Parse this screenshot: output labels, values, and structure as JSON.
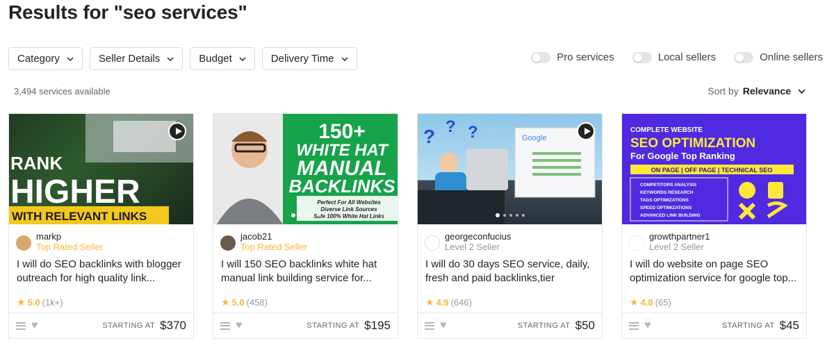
{
  "page_title": "Results for \"seo services\"",
  "filters": [
    "Category",
    "Seller Details",
    "Budget",
    "Delivery Time"
  ],
  "toggles": [
    "Pro services",
    "Local sellers",
    "Online sellers"
  ],
  "services_count": "3,494 services available",
  "sort": {
    "label": "Sort by",
    "value": "Relevance"
  },
  "footer": {
    "starting_at": "STARTING AT"
  },
  "gigs": [
    {
      "seller": "markp",
      "level": "Top Rated Seller",
      "title": "I will do SEO backlinks with blogger outreach for high quality link...",
      "rating": "5.0",
      "reviews": "(1k+)",
      "price": "$370",
      "thumb_text": [
        "RANK",
        "HIGHER",
        "WITH RELEVANT LINKS"
      ]
    },
    {
      "seller": "jacob21",
      "level": "Top Rated Seller",
      "title": "I will 150 SEO backlinks white hat manual link building service for...",
      "rating": "5.0",
      "reviews": "(458)",
      "price": "$195",
      "thumb_text": [
        "150+",
        "WHITE HAT",
        "MANUAL",
        "BACKLINKS",
        "Perfect For All Websites",
        "Diverse Link Sources",
        "Safe 100% White Hat Links"
      ]
    },
    {
      "seller": "georgeconfucius",
      "level": "Level 2 Seller",
      "title": "I will do 30 days SEO service, daily, fresh and paid backlinks,tier",
      "rating": "4.9",
      "reviews": "(646)",
      "price": "$50",
      "thumb_text": [
        "?",
        "?",
        "?",
        "Google"
      ]
    },
    {
      "seller": "growthpartner1",
      "level": "Level 2 Seller",
      "title": "I will do website on page SEO optimization service for google top...",
      "rating": "4.8",
      "reviews": "(65)",
      "price": "$45",
      "thumb_text": [
        "COMPLETE WEBSITE",
        "SEO OPTIMIZATION",
        "For Google Top Ranking",
        "ON PAGE | OFF PAGE | TECHNICAL SEO",
        "COMPETITORS ANALYSIS",
        "KEYWORDS RESEARCH",
        "TAGS OPTIMIZATIONS",
        "SPEED OPTIMIZATIONS",
        "ADVANCED LINK BUILDING"
      ]
    }
  ]
}
